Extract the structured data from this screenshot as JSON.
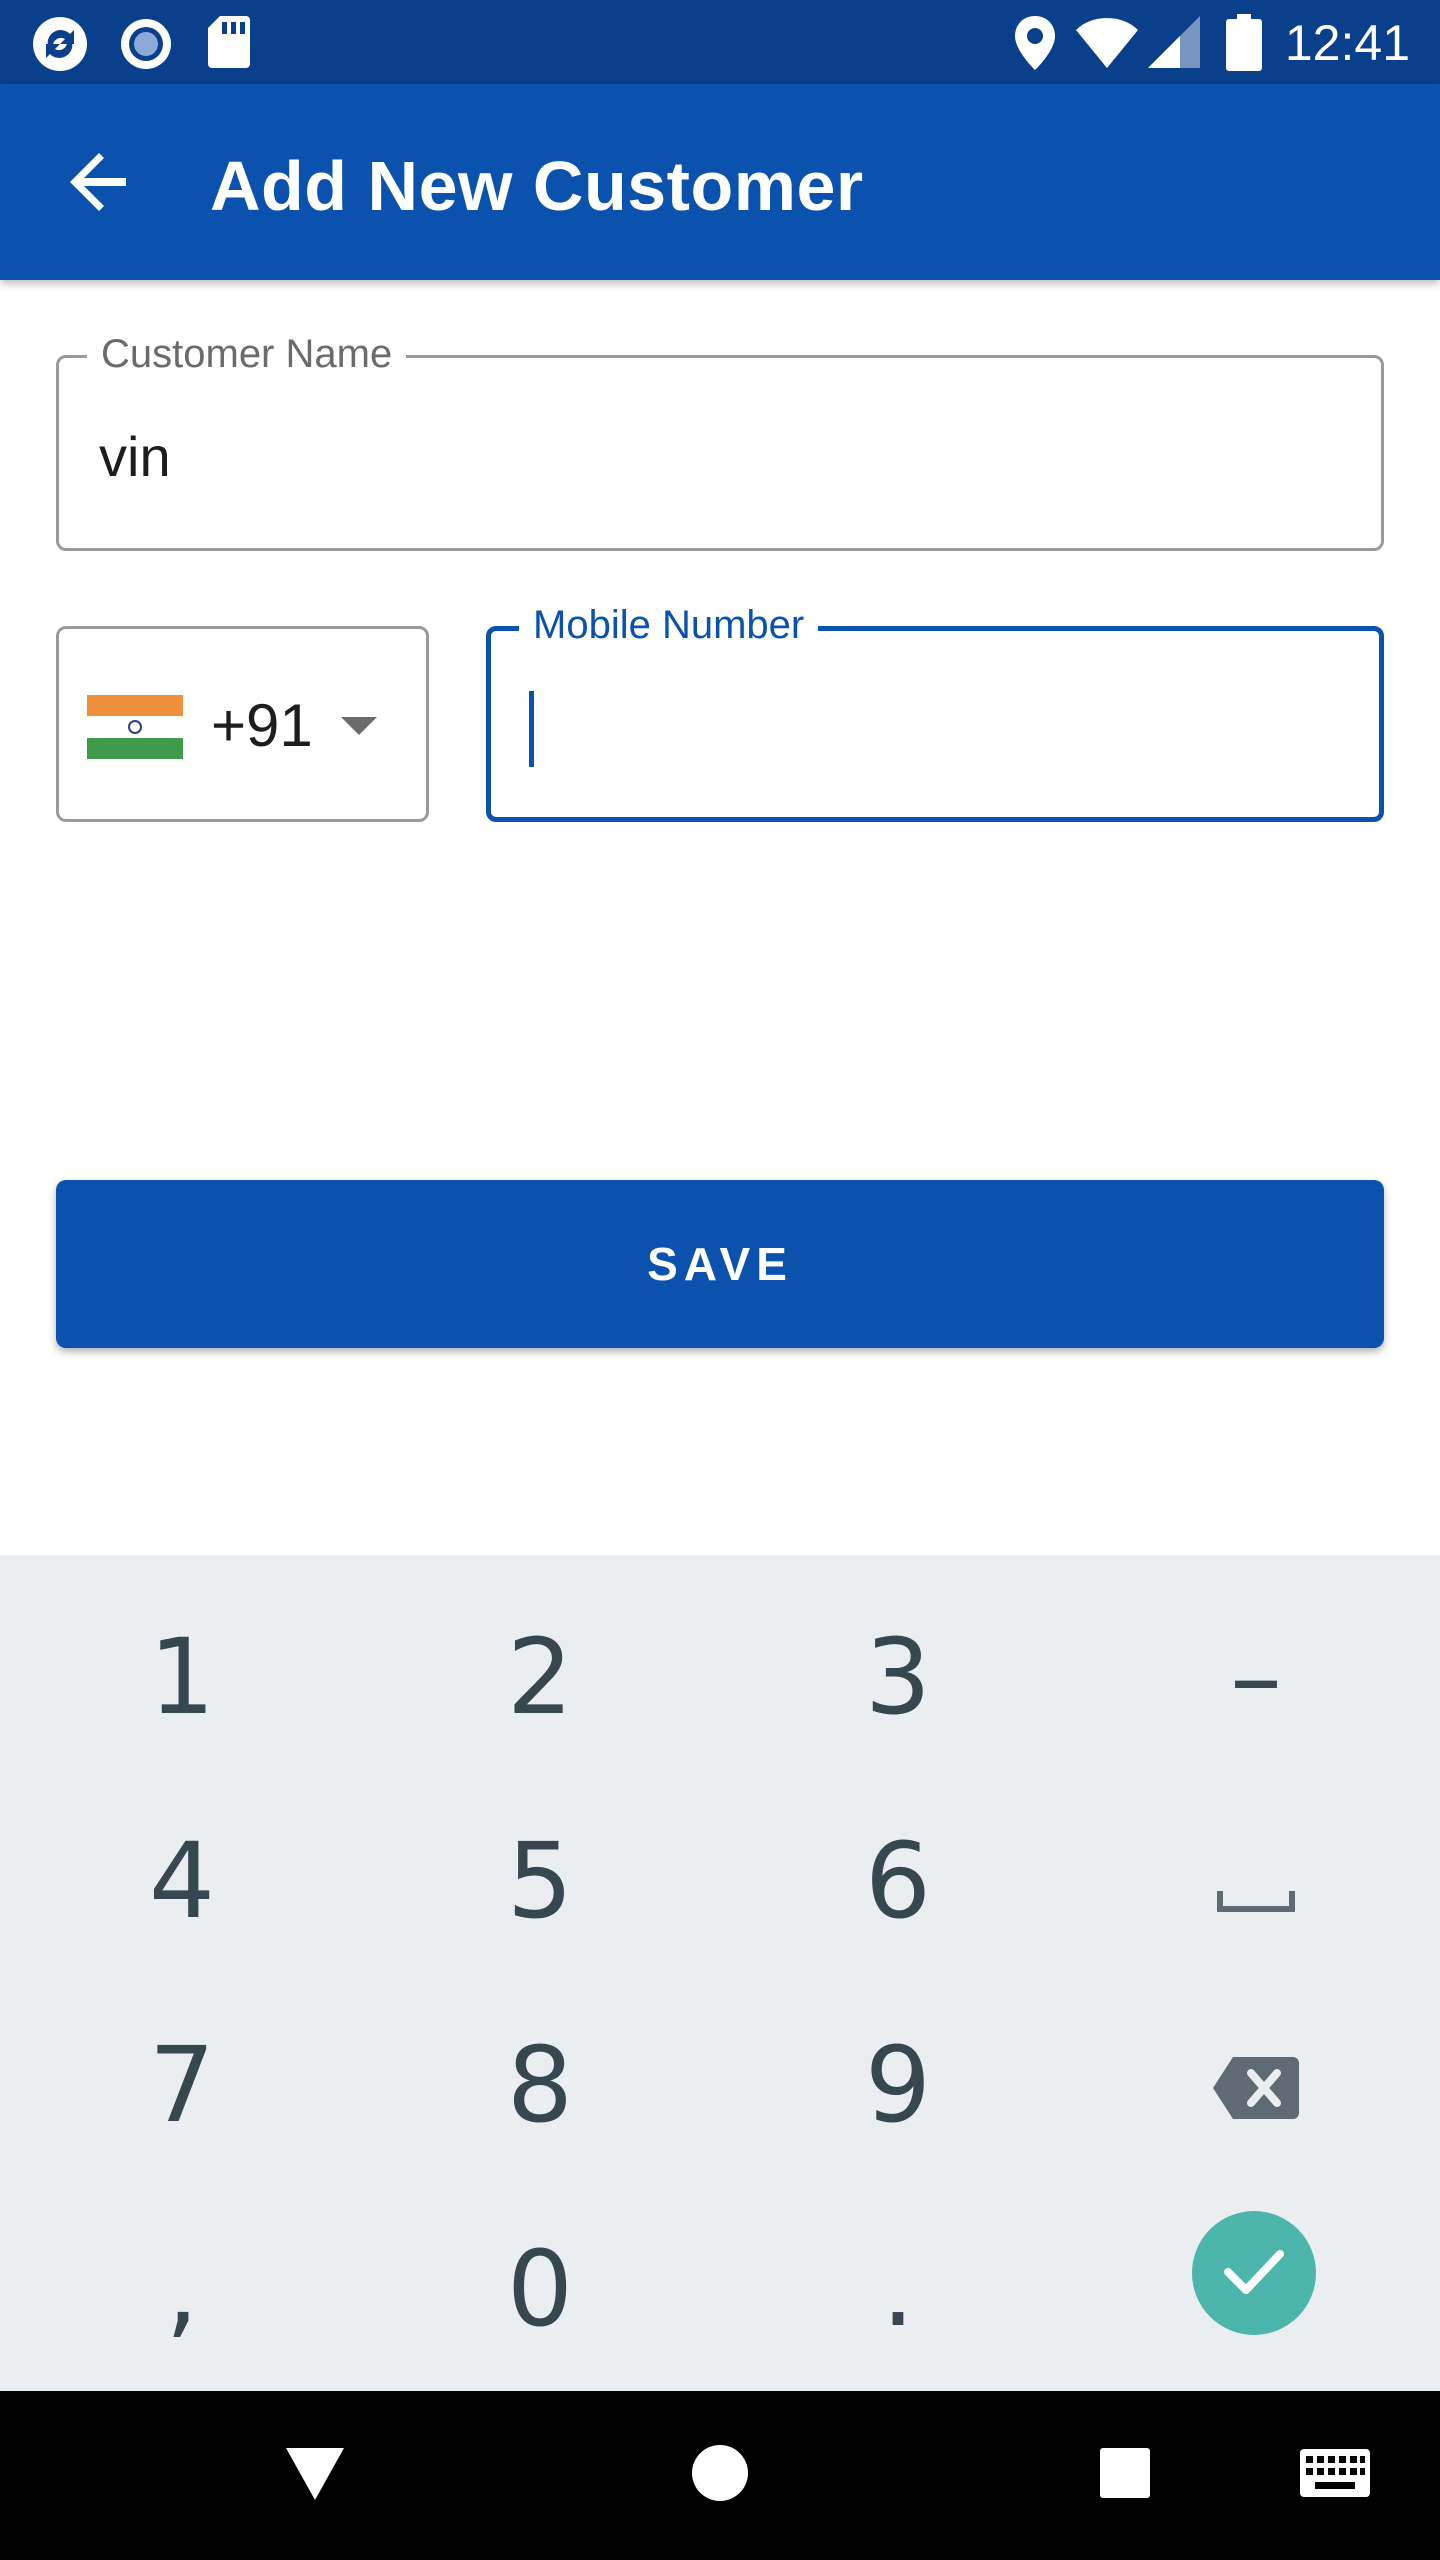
{
  "status_bar": {
    "time": "12:41",
    "icons": [
      "app-sync-icon",
      "record-icon",
      "sd-card-icon",
      "location-icon",
      "wifi-icon",
      "signal-icon",
      "battery-icon"
    ]
  },
  "app_bar": {
    "title": "Add New Customer",
    "back_icon": "arrow-left-icon"
  },
  "form": {
    "customer_name": {
      "label": "Customer Name",
      "value": "vin"
    },
    "country_code": {
      "flag": "india-flag-icon",
      "value": "+91"
    },
    "mobile_number": {
      "label": "Mobile Number",
      "value": ""
    },
    "save_label": "SAVE"
  },
  "keyboard": {
    "keys": [
      [
        "1",
        "2",
        "3",
        "–"
      ],
      [
        "4",
        "5",
        "6",
        "space"
      ],
      [
        "7",
        "8",
        "9",
        "backspace"
      ],
      [
        ",",
        "0",
        ".",
        "done"
      ]
    ]
  },
  "nav_bar": {
    "items": [
      "back-triangle-icon",
      "home-circle-icon",
      "recents-square-icon",
      "keyboard-icon"
    ]
  },
  "colors": {
    "status_bar": "#0A3F8C",
    "primary": "#0A52AE",
    "keyboard_bg": "#EBEEF1",
    "done_key": "#4DB6AC"
  }
}
